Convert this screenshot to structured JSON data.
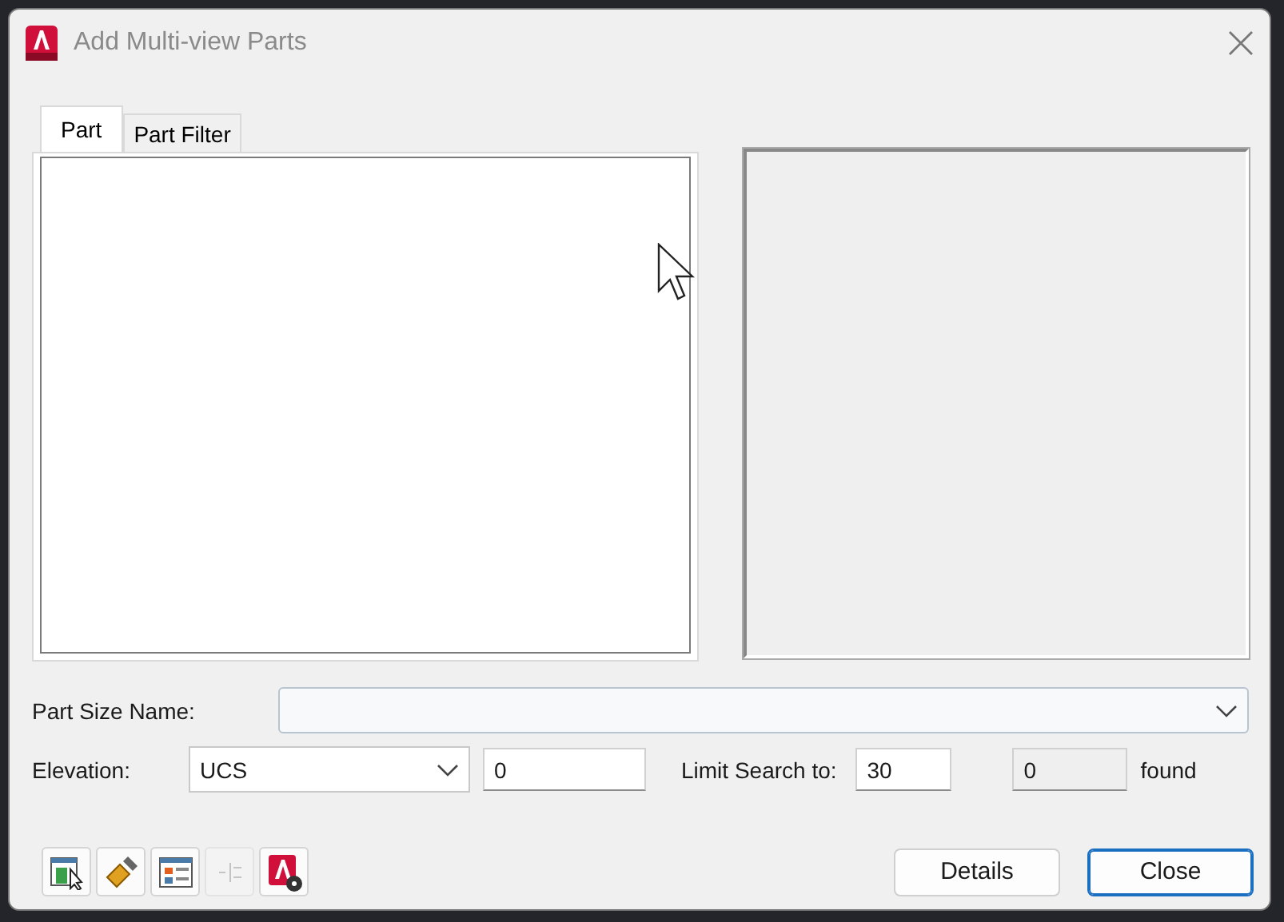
{
  "window": {
    "title": "Add Multi-view Parts"
  },
  "tabs": [
    {
      "label": "Part",
      "selected": true
    },
    {
      "label": "Part Filter",
      "selected": false
    }
  ],
  "part_size_name": {
    "label": "Part Size Name:"
  },
  "elevation": {
    "label": "Elevation:",
    "mode": "UCS",
    "value": "0"
  },
  "limit_search": {
    "label": "Limit Search to:",
    "value": "30",
    "found_count": "0",
    "found_label": "found"
  },
  "tools": [
    {
      "kind": "select",
      "disabled": false
    },
    {
      "kind": "brush",
      "disabled": false
    },
    {
      "kind": "layout",
      "disabled": false
    },
    {
      "kind": "align",
      "disabled": true
    },
    {
      "kind": "help",
      "disabled": false
    }
  ],
  "buttons": [
    {
      "label": "Details",
      "default": false
    },
    {
      "label": "Close",
      "default": true
    }
  ]
}
